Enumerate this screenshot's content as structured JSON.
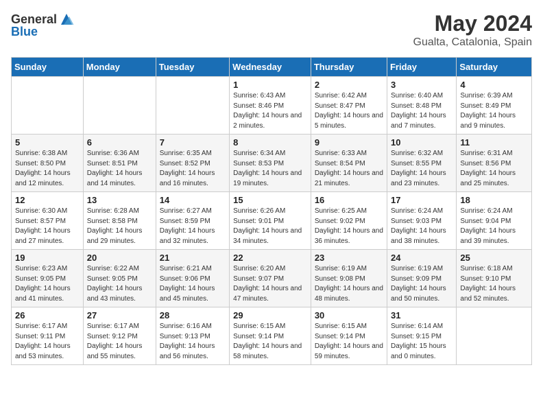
{
  "header": {
    "logo": {
      "general": "General",
      "blue": "Blue"
    },
    "title": "May 2024",
    "location": "Gualta, Catalonia, Spain"
  },
  "weekdays": [
    "Sunday",
    "Monday",
    "Tuesday",
    "Wednesday",
    "Thursday",
    "Friday",
    "Saturday"
  ],
  "weeks": [
    [
      {
        "day": "",
        "sunrise": "",
        "sunset": "",
        "daylight": ""
      },
      {
        "day": "",
        "sunrise": "",
        "sunset": "",
        "daylight": ""
      },
      {
        "day": "",
        "sunrise": "",
        "sunset": "",
        "daylight": ""
      },
      {
        "day": "1",
        "sunrise": "Sunrise: 6:43 AM",
        "sunset": "Sunset: 8:46 PM",
        "daylight": "Daylight: 14 hours and 2 minutes."
      },
      {
        "day": "2",
        "sunrise": "Sunrise: 6:42 AM",
        "sunset": "Sunset: 8:47 PM",
        "daylight": "Daylight: 14 hours and 5 minutes."
      },
      {
        "day": "3",
        "sunrise": "Sunrise: 6:40 AM",
        "sunset": "Sunset: 8:48 PM",
        "daylight": "Daylight: 14 hours and 7 minutes."
      },
      {
        "day": "4",
        "sunrise": "Sunrise: 6:39 AM",
        "sunset": "Sunset: 8:49 PM",
        "daylight": "Daylight: 14 hours and 9 minutes."
      }
    ],
    [
      {
        "day": "5",
        "sunrise": "Sunrise: 6:38 AM",
        "sunset": "Sunset: 8:50 PM",
        "daylight": "Daylight: 14 hours and 12 minutes."
      },
      {
        "day": "6",
        "sunrise": "Sunrise: 6:36 AM",
        "sunset": "Sunset: 8:51 PM",
        "daylight": "Daylight: 14 hours and 14 minutes."
      },
      {
        "day": "7",
        "sunrise": "Sunrise: 6:35 AM",
        "sunset": "Sunset: 8:52 PM",
        "daylight": "Daylight: 14 hours and 16 minutes."
      },
      {
        "day": "8",
        "sunrise": "Sunrise: 6:34 AM",
        "sunset": "Sunset: 8:53 PM",
        "daylight": "Daylight: 14 hours and 19 minutes."
      },
      {
        "day": "9",
        "sunrise": "Sunrise: 6:33 AM",
        "sunset": "Sunset: 8:54 PM",
        "daylight": "Daylight: 14 hours and 21 minutes."
      },
      {
        "day": "10",
        "sunrise": "Sunrise: 6:32 AM",
        "sunset": "Sunset: 8:55 PM",
        "daylight": "Daylight: 14 hours and 23 minutes."
      },
      {
        "day": "11",
        "sunrise": "Sunrise: 6:31 AM",
        "sunset": "Sunset: 8:56 PM",
        "daylight": "Daylight: 14 hours and 25 minutes."
      }
    ],
    [
      {
        "day": "12",
        "sunrise": "Sunrise: 6:30 AM",
        "sunset": "Sunset: 8:57 PM",
        "daylight": "Daylight: 14 hours and 27 minutes."
      },
      {
        "day": "13",
        "sunrise": "Sunrise: 6:28 AM",
        "sunset": "Sunset: 8:58 PM",
        "daylight": "Daylight: 14 hours and 29 minutes."
      },
      {
        "day": "14",
        "sunrise": "Sunrise: 6:27 AM",
        "sunset": "Sunset: 8:59 PM",
        "daylight": "Daylight: 14 hours and 32 minutes."
      },
      {
        "day": "15",
        "sunrise": "Sunrise: 6:26 AM",
        "sunset": "Sunset: 9:01 PM",
        "daylight": "Daylight: 14 hours and 34 minutes."
      },
      {
        "day": "16",
        "sunrise": "Sunrise: 6:25 AM",
        "sunset": "Sunset: 9:02 PM",
        "daylight": "Daylight: 14 hours and 36 minutes."
      },
      {
        "day": "17",
        "sunrise": "Sunrise: 6:24 AM",
        "sunset": "Sunset: 9:03 PM",
        "daylight": "Daylight: 14 hours and 38 minutes."
      },
      {
        "day": "18",
        "sunrise": "Sunrise: 6:24 AM",
        "sunset": "Sunset: 9:04 PM",
        "daylight": "Daylight: 14 hours and 39 minutes."
      }
    ],
    [
      {
        "day": "19",
        "sunrise": "Sunrise: 6:23 AM",
        "sunset": "Sunset: 9:05 PM",
        "daylight": "Daylight: 14 hours and 41 minutes."
      },
      {
        "day": "20",
        "sunrise": "Sunrise: 6:22 AM",
        "sunset": "Sunset: 9:05 PM",
        "daylight": "Daylight: 14 hours and 43 minutes."
      },
      {
        "day": "21",
        "sunrise": "Sunrise: 6:21 AM",
        "sunset": "Sunset: 9:06 PM",
        "daylight": "Daylight: 14 hours and 45 minutes."
      },
      {
        "day": "22",
        "sunrise": "Sunrise: 6:20 AM",
        "sunset": "Sunset: 9:07 PM",
        "daylight": "Daylight: 14 hours and 47 minutes."
      },
      {
        "day": "23",
        "sunrise": "Sunrise: 6:19 AM",
        "sunset": "Sunset: 9:08 PM",
        "daylight": "Daylight: 14 hours and 48 minutes."
      },
      {
        "day": "24",
        "sunrise": "Sunrise: 6:19 AM",
        "sunset": "Sunset: 9:09 PM",
        "daylight": "Daylight: 14 hours and 50 minutes."
      },
      {
        "day": "25",
        "sunrise": "Sunrise: 6:18 AM",
        "sunset": "Sunset: 9:10 PM",
        "daylight": "Daylight: 14 hours and 52 minutes."
      }
    ],
    [
      {
        "day": "26",
        "sunrise": "Sunrise: 6:17 AM",
        "sunset": "Sunset: 9:11 PM",
        "daylight": "Daylight: 14 hours and 53 minutes."
      },
      {
        "day": "27",
        "sunrise": "Sunrise: 6:17 AM",
        "sunset": "Sunset: 9:12 PM",
        "daylight": "Daylight: 14 hours and 55 minutes."
      },
      {
        "day": "28",
        "sunrise": "Sunrise: 6:16 AM",
        "sunset": "Sunset: 9:13 PM",
        "daylight": "Daylight: 14 hours and 56 minutes."
      },
      {
        "day": "29",
        "sunrise": "Sunrise: 6:15 AM",
        "sunset": "Sunset: 9:14 PM",
        "daylight": "Daylight: 14 hours and 58 minutes."
      },
      {
        "day": "30",
        "sunrise": "Sunrise: 6:15 AM",
        "sunset": "Sunset: 9:14 PM",
        "daylight": "Daylight: 14 hours and 59 minutes."
      },
      {
        "day": "31",
        "sunrise": "Sunrise: 6:14 AM",
        "sunset": "Sunset: 9:15 PM",
        "daylight": "Daylight: 15 hours and 0 minutes."
      },
      {
        "day": "",
        "sunrise": "",
        "sunset": "",
        "daylight": ""
      }
    ]
  ]
}
